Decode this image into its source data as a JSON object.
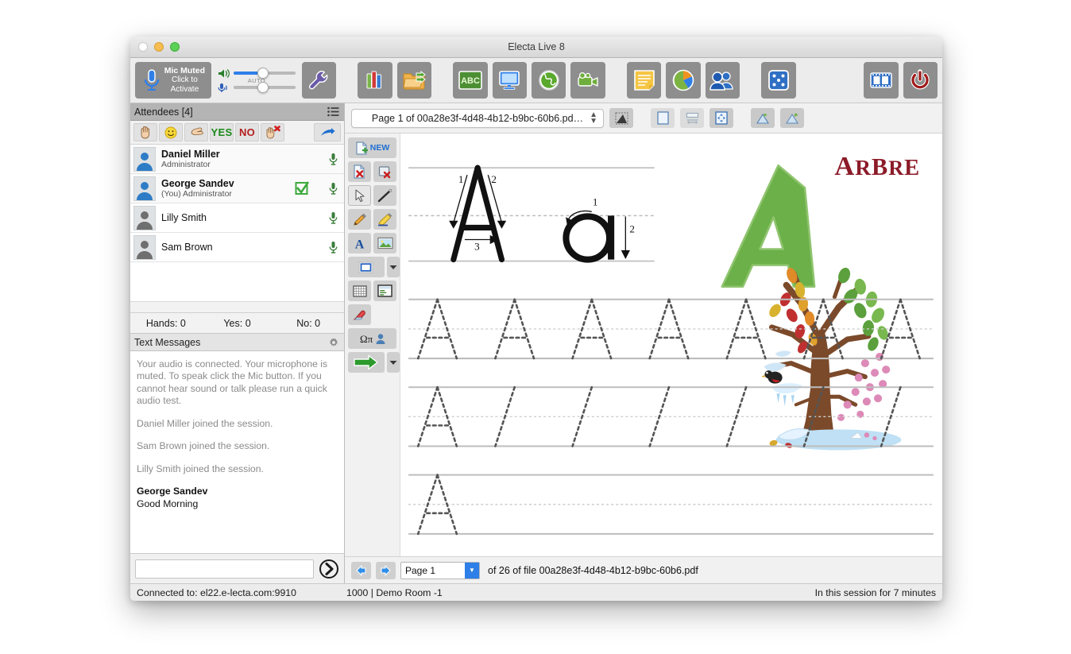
{
  "window": {
    "title": "Electa Live 8",
    "traffic_lights": [
      "close",
      "minimize",
      "zoom"
    ]
  },
  "toolbar": {
    "mic": {
      "line1": "Mic Muted",
      "line2": "Click to",
      "line3": "Activate",
      "icon": "microphone-icon"
    },
    "sliders": {
      "speaker_icon": "speaker-volume-icon",
      "speaker_value": 45,
      "mic_icon": "microphone-level-icon",
      "auto_label": "AUTO",
      "mic_value": 45
    },
    "buttons": [
      {
        "name": "settings-wrench-button",
        "icon": "wrench-icon",
        "label": ""
      },
      {
        "name": "library-button",
        "icon": "books-icon",
        "label": ""
      },
      {
        "name": "open-folder-button",
        "icon": "folder-share-icon",
        "label": ""
      },
      {
        "name": "whiteboard-button",
        "icon": "abc-chalkboard-icon",
        "label": "ABC"
      },
      {
        "name": "desktop-share-button",
        "icon": "monitor-icon",
        "label": ""
      },
      {
        "name": "web-tour-button",
        "icon": "globe-icon",
        "label": ""
      },
      {
        "name": "video-button",
        "icon": "camcorder-icon",
        "label": ""
      },
      {
        "name": "notes-button",
        "icon": "sticky-note-icon",
        "label": ""
      },
      {
        "name": "polls-button",
        "icon": "pie-chart-icon",
        "label": ""
      },
      {
        "name": "breakout-rooms-button",
        "icon": "users-icon",
        "label": ""
      },
      {
        "name": "dice-button",
        "icon": "dice-icon",
        "label": ""
      },
      {
        "name": "recording-button",
        "icon": "film-strip-icon",
        "label": ""
      },
      {
        "name": "exit-session-button",
        "icon": "power-icon",
        "label": ""
      }
    ]
  },
  "attendees_panel": {
    "header": "Attendees [4]",
    "header_icon": "list-menu-icon",
    "actions": [
      {
        "name": "raise-hand-button",
        "icon": "raised-hand-icon",
        "label": ""
      },
      {
        "name": "smile-button",
        "icon": "smiley-icon",
        "label": ""
      },
      {
        "name": "applause-button",
        "icon": "clap-hand-icon",
        "label": ""
      },
      {
        "name": "yes-button",
        "icon": "yes-text-icon",
        "label": "YES"
      },
      {
        "name": "no-button",
        "icon": "no-text-icon",
        "label": "NO"
      },
      {
        "name": "clear-hands-button",
        "icon": "hand-clear-icon",
        "label": ""
      },
      {
        "name": "share-button",
        "icon": "blue-arrow-icon",
        "label": ""
      }
    ],
    "list": [
      {
        "name": "Daniel Miller",
        "role": "Administrator",
        "bold": true,
        "active_avatar": true,
        "checked": false,
        "mic_icon": "microphone-icon"
      },
      {
        "name": "George Sandev",
        "role": "(You) Administrator",
        "bold": true,
        "active_avatar": true,
        "checked": true,
        "mic_icon": "microphone-icon"
      },
      {
        "name": "Lilly Smith",
        "role": "",
        "bold": false,
        "active_avatar": false,
        "checked": false,
        "mic_icon": "microphone-icon"
      },
      {
        "name": "Sam Brown",
        "role": "",
        "bold": false,
        "active_avatar": false,
        "checked": false,
        "mic_icon": "microphone-icon"
      }
    ],
    "counts": {
      "hands": "Hands: 0",
      "yes": "Yes: 0",
      "no": "No: 0"
    }
  },
  "chat_panel": {
    "header": "Text Messages",
    "settings_icon": "gear-icon",
    "messages": [
      {
        "type": "system",
        "text": "Your audio is connected. Your microphone is muted. To speak click the Mic button. If you cannot hear sound or talk please run a quick audio test."
      },
      {
        "type": "system",
        "text": "Daniel Miller joined the session."
      },
      {
        "type": "system",
        "text": "Sam Brown joined the session."
      },
      {
        "type": "system",
        "text": "Lilly Smith joined the session."
      },
      {
        "type": "user",
        "author": "George Sandev",
        "text": "Good Morning"
      }
    ],
    "input_value": "",
    "input_placeholder": "",
    "send_icon": "send-arrow-icon"
  },
  "whiteboard": {
    "page_selector": "Page 1 of 00a28e3f-4d48-4b12-b9bc-60b6.pd…",
    "view_buttons": [
      {
        "name": "select-region-button",
        "icon": "marquee-icon"
      },
      {
        "name": "fit-page-button",
        "icon": "page-icon"
      },
      {
        "name": "fit-width-button",
        "icon": "fit-width-icon"
      },
      {
        "name": "fit-screen-button",
        "icon": "fit-screen-icon"
      },
      {
        "name": "zoom-out-button",
        "icon": "zoom-out-icon"
      },
      {
        "name": "zoom-in-button",
        "icon": "zoom-in-icon"
      }
    ],
    "tools": [
      {
        "name": "new-page-tool",
        "icon": "new-page-icon",
        "label": "NEW"
      },
      {
        "name": "delete-page-tool",
        "icon": "delete-page-icon",
        "label": ""
      },
      {
        "name": "clear-page-tool",
        "icon": "clear-page-icon",
        "label": ""
      },
      {
        "name": "pointer-tool",
        "icon": "arrow-cursor-icon",
        "label": "",
        "selected": true
      },
      {
        "name": "line-tool",
        "icon": "line-icon",
        "label": ""
      },
      {
        "name": "pencil-tool",
        "icon": "pencil-icon",
        "label": ""
      },
      {
        "name": "highlighter-tool",
        "icon": "highlighter-icon",
        "label": ""
      },
      {
        "name": "text-tool",
        "icon": "text-a-icon",
        "label": ""
      },
      {
        "name": "image-tool",
        "icon": "image-icon",
        "label": ""
      },
      {
        "name": "shape-tool",
        "icon": "rectangle-icon",
        "label": ""
      },
      {
        "name": "shape-dropdown",
        "icon": "chevron-down-icon",
        "label": ""
      },
      {
        "name": "grid-tool",
        "icon": "grid-icon",
        "label": ""
      },
      {
        "name": "table-tool",
        "icon": "table-icon",
        "label": ""
      },
      {
        "name": "eraser-tool",
        "icon": "eraser-icon",
        "label": ""
      },
      {
        "name": "symbols-tool",
        "icon": "omega-pi-icon",
        "label": ""
      },
      {
        "name": "next-tool",
        "icon": "green-arrow-icon",
        "label": ""
      },
      {
        "name": "next-dropdown",
        "icon": "chevron-down-icon",
        "label": ""
      }
    ],
    "page_nav": {
      "prev_icon": "left-arrow-icon",
      "next_icon": "right-arrow-icon",
      "page_value": "Page 1",
      "info": "of 26 of file 00a28e3f-4d48-4b12-b9bc-60b6.pdf"
    },
    "content": {
      "title_letter": "A",
      "title_word": "ARBRE",
      "title_letter_color": "#6cb04a",
      "title_word_color": "#8c1b28",
      "uppercase_strokes": [
        "1",
        "2",
        "3"
      ],
      "lowercase_strokes": [
        "1",
        "2"
      ],
      "practice_rows": [
        {
          "guide_count": 7,
          "full_letters": 7
        },
        {
          "guide_count": 7,
          "full_letters": 1
        },
        {
          "guide_count": 1,
          "full_letters": 1
        }
      ]
    }
  },
  "statusbar": {
    "connection": "Connected to: el22.e-lecta.com:9910",
    "room": "1000 | Demo Room -1",
    "session_time": "In this session for 7 minutes"
  }
}
